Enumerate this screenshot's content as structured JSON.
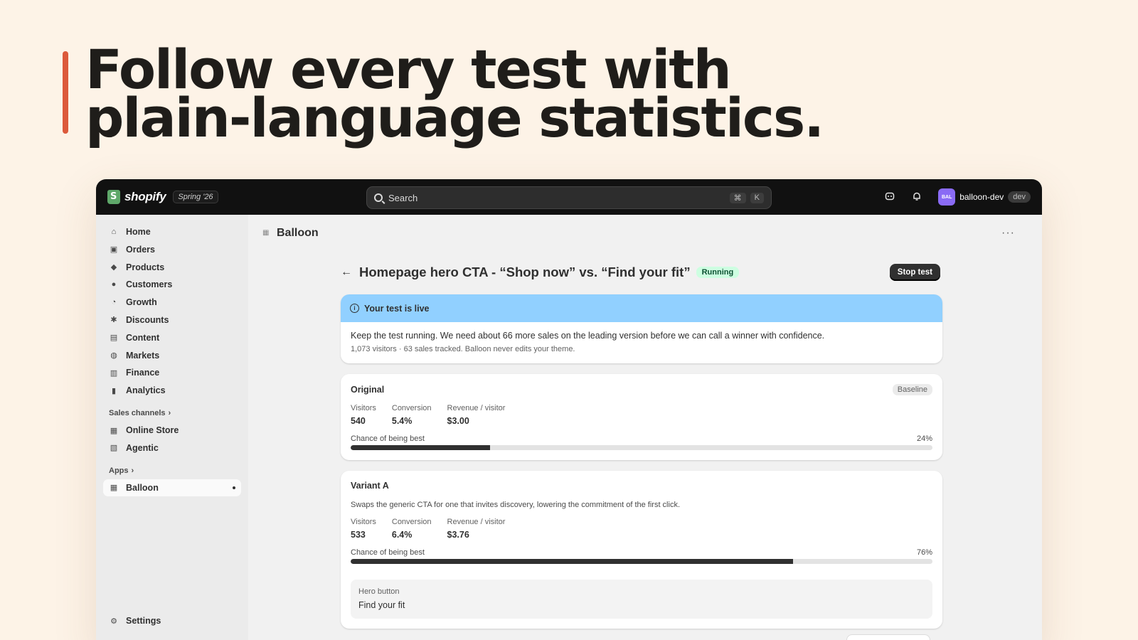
{
  "hero": {
    "line1": "Follow every test with",
    "line2": "plain-language statistics."
  },
  "topbar": {
    "logo": "shopify",
    "edition": "Spring '26",
    "search_placeholder": "Search",
    "shortcut_keys": [
      "⌘",
      "K"
    ],
    "avatar_initials": "BAL",
    "account_name": "balloon-dev",
    "env_badge": "dev"
  },
  "sidebar": {
    "items": [
      {
        "label": "Home",
        "icon": "home-icon"
      },
      {
        "label": "Orders",
        "icon": "inbox-icon"
      },
      {
        "label": "Products",
        "icon": "tag-icon"
      },
      {
        "label": "Customers",
        "icon": "person-icon"
      },
      {
        "label": "Growth",
        "icon": "gauge-icon"
      },
      {
        "label": "Discounts",
        "icon": "discount-icon"
      },
      {
        "label": "Content",
        "icon": "image-icon"
      },
      {
        "label": "Markets",
        "icon": "globe-icon"
      },
      {
        "label": "Finance",
        "icon": "bank-icon"
      },
      {
        "label": "Analytics",
        "icon": "chart-bar-icon"
      }
    ],
    "sales_channels_heading": "Sales channels",
    "sales_channels": [
      {
        "label": "Online Store",
        "icon": "store-icon"
      },
      {
        "label": "Agentic",
        "icon": "agent-icon"
      }
    ],
    "apps_heading": "Apps",
    "apps": [
      {
        "label": "Balloon",
        "icon": "app-icon"
      }
    ],
    "settings_label": "Settings"
  },
  "main": {
    "app_name": "Balloon",
    "page_title": "Homepage hero CTA - “Shop now” vs. “Find your fit”",
    "status": "Running",
    "stop_label": "Stop test",
    "banner": {
      "title": "Your test is live",
      "text": "Keep the test running. We need about 66 more sales on the leading version before we can call a winner with confidence.",
      "sub": "1,073 visitors · 63 sales tracked. Balloon never edits your theme."
    },
    "original": {
      "title": "Original",
      "badge": "Baseline",
      "visitors_label": "Visitors",
      "visitors": "540",
      "conversion_label": "Conversion",
      "conversion": "5.4%",
      "revenue_label": "Revenue / visitor",
      "revenue": "$3.00",
      "chance_label": "Chance of being best",
      "chance_text": "24%",
      "chance_value": 24
    },
    "variant": {
      "title": "Variant A",
      "description": "Swaps the generic CTA for one that invites discovery, lowering the commitment of the first click.",
      "visitors_label": "Visitors",
      "visitors": "533",
      "conversion_label": "Conversion",
      "conversion": "6.4%",
      "revenue_label": "Revenue / visitor",
      "revenue": "$3.76",
      "chance_label": "Chance of being best",
      "chance_text": "76%",
      "chance_value": 76,
      "field_label": "Hero button",
      "field_value": "Find your fit"
    }
  },
  "colors": {
    "accent": "#dc5a3c",
    "background": "#fdf3e7",
    "topbar": "#111111",
    "banner": "#91d0ff",
    "running_badge": "#cdfee1"
  }
}
